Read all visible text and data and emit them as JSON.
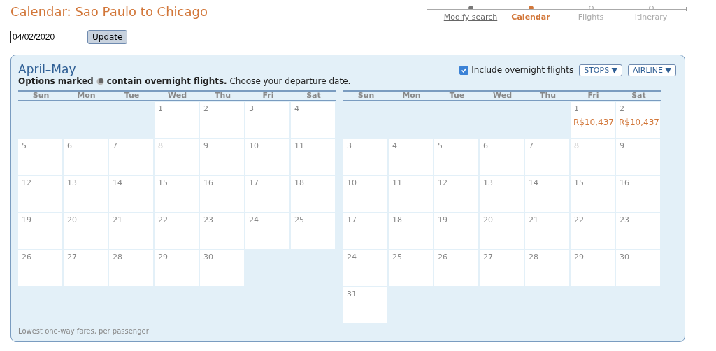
{
  "title": "Calendar: Sao Paulo to Chicago",
  "steps": [
    {
      "label": "Modify search",
      "kind": "done"
    },
    {
      "label": "Calendar",
      "kind": "current"
    },
    {
      "label": "Flights",
      "kind": "future"
    },
    {
      "label": "Itinerary",
      "kind": "future"
    }
  ],
  "date_field": {
    "value": "04/02/2020"
  },
  "update_button": "Update",
  "panel": {
    "heading": "April–May",
    "note_bold_1": "Options marked",
    "note_bold_2": "contain overnight flights.",
    "note_rest": "Choose your departure date.",
    "overnight": {
      "label": "Include overnight flights",
      "checked": true
    },
    "filters": [
      {
        "label": "STOPS",
        "caret": "▼"
      },
      {
        "label": "AIRLINE",
        "caret": "▼"
      }
    ],
    "footer": "Lowest one-way fares, per passenger"
  },
  "months": [
    {
      "weekdays": [
        "Sun",
        "Mon",
        "Tue",
        "Wed",
        "Thu",
        "Fri",
        "Sat"
      ],
      "weeks": [
        [
          {
            "kind": "blank"
          },
          {
            "kind": "blank"
          },
          {
            "kind": "blank"
          },
          {
            "kind": "day",
            "day": "1"
          },
          {
            "kind": "day",
            "day": "2"
          },
          {
            "kind": "day",
            "day": "3"
          },
          {
            "kind": "day",
            "day": "4"
          }
        ],
        [
          {
            "kind": "day",
            "day": "5"
          },
          {
            "kind": "day",
            "day": "6"
          },
          {
            "kind": "day",
            "day": "7"
          },
          {
            "kind": "day",
            "day": "8"
          },
          {
            "kind": "day",
            "day": "9"
          },
          {
            "kind": "day",
            "day": "10"
          },
          {
            "kind": "day",
            "day": "11"
          }
        ],
        [
          {
            "kind": "day",
            "day": "12"
          },
          {
            "kind": "day",
            "day": "13"
          },
          {
            "kind": "day",
            "day": "14"
          },
          {
            "kind": "day",
            "day": "15"
          },
          {
            "kind": "day",
            "day": "16"
          },
          {
            "kind": "day",
            "day": "17"
          },
          {
            "kind": "day",
            "day": "18"
          }
        ],
        [
          {
            "kind": "day",
            "day": "19"
          },
          {
            "kind": "day",
            "day": "20"
          },
          {
            "kind": "day",
            "day": "21"
          },
          {
            "kind": "day",
            "day": "22"
          },
          {
            "kind": "day",
            "day": "23"
          },
          {
            "kind": "day",
            "day": "24"
          },
          {
            "kind": "day",
            "day": "25"
          }
        ],
        [
          {
            "kind": "day",
            "day": "26"
          },
          {
            "kind": "day",
            "day": "27"
          },
          {
            "kind": "day",
            "day": "28"
          },
          {
            "kind": "day",
            "day": "29"
          },
          {
            "kind": "day",
            "day": "30"
          },
          {
            "kind": "blank"
          },
          {
            "kind": "blank"
          }
        ]
      ]
    },
    {
      "weekdays": [
        "Sun",
        "Mon",
        "Tue",
        "Wed",
        "Thu",
        "Fri",
        "Sat"
      ],
      "weeks": [
        [
          {
            "kind": "blank"
          },
          {
            "kind": "blank"
          },
          {
            "kind": "blank"
          },
          {
            "kind": "blank"
          },
          {
            "kind": "blank"
          },
          {
            "kind": "day",
            "day": "1",
            "fare": "R$10,437"
          },
          {
            "kind": "day",
            "day": "2",
            "fare": "R$10,437"
          }
        ],
        [
          {
            "kind": "day",
            "day": "3"
          },
          {
            "kind": "day",
            "day": "4"
          },
          {
            "kind": "day",
            "day": "5"
          },
          {
            "kind": "day",
            "day": "6"
          },
          {
            "kind": "day",
            "day": "7"
          },
          {
            "kind": "day",
            "day": "8"
          },
          {
            "kind": "day",
            "day": "9"
          }
        ],
        [
          {
            "kind": "day",
            "day": "10"
          },
          {
            "kind": "day",
            "day": "11"
          },
          {
            "kind": "day",
            "day": "12"
          },
          {
            "kind": "day",
            "day": "13"
          },
          {
            "kind": "day",
            "day": "14"
          },
          {
            "kind": "day",
            "day": "15"
          },
          {
            "kind": "day",
            "day": "16"
          }
        ],
        [
          {
            "kind": "day",
            "day": "17"
          },
          {
            "kind": "day",
            "day": "18"
          },
          {
            "kind": "day",
            "day": "19"
          },
          {
            "kind": "day",
            "day": "20"
          },
          {
            "kind": "day",
            "day": "21"
          },
          {
            "kind": "day",
            "day": "22"
          },
          {
            "kind": "day",
            "day": "23"
          }
        ],
        [
          {
            "kind": "day",
            "day": "24"
          },
          {
            "kind": "day",
            "day": "25"
          },
          {
            "kind": "day",
            "day": "26"
          },
          {
            "kind": "day",
            "day": "27"
          },
          {
            "kind": "day",
            "day": "28"
          },
          {
            "kind": "day",
            "day": "29"
          },
          {
            "kind": "day",
            "day": "30"
          }
        ],
        [
          {
            "kind": "day",
            "day": "31"
          },
          {
            "kind": "blank"
          },
          {
            "kind": "blank"
          },
          {
            "kind": "blank"
          },
          {
            "kind": "blank"
          },
          {
            "kind": "blank"
          },
          {
            "kind": "blank"
          }
        ]
      ]
    }
  ]
}
